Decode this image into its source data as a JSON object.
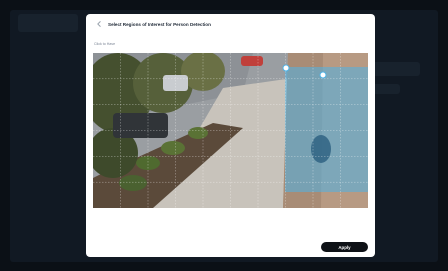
{
  "modal": {
    "title": "Select Regions of Interest for Person Detection",
    "subtitle": "Click to Have",
    "back_icon": "chevron-left-icon",
    "apply_label": "Apply"
  },
  "camera": {
    "grid": {
      "rows": 6,
      "cols": 10
    },
    "selected_region_color": "#4fb3e6"
  }
}
